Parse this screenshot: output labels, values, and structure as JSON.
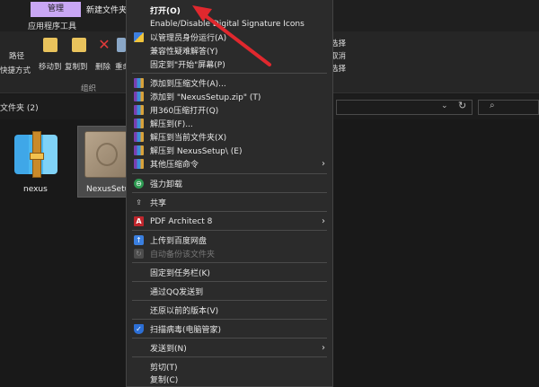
{
  "window": {
    "manage_tab": "管理",
    "title": "新建文件夹 (",
    "app_tools_tab": "应用程序工具"
  },
  "ribbon": {
    "path_label": "路径",
    "shortcut_label": "快捷方式",
    "move_to": "移动到",
    "copy_to": "复制到",
    "delete": "删除",
    "rename": "重命",
    "group_label": "组织",
    "select_all": "选择",
    "cancel_select": "取消",
    "invert_select": "选择"
  },
  "address": {
    "path": "文件夹 (2)",
    "dropdown_icon": "chevron-down-icon",
    "refresh_icon": "refresh-icon",
    "search_icon": "search-icon"
  },
  "files": [
    {
      "name": "nexus",
      "icon": "winrar-archive-icon"
    },
    {
      "name": "NexusSetup",
      "icon": "installer-box-icon"
    }
  ],
  "menu": {
    "items": [
      {
        "label": "打开(O)"
      },
      {
        "label": "Enable/Disable Digital Signature Icons"
      },
      {
        "label": "以管理员身份运行(A)"
      },
      {
        "label": "兼容性疑难解答(Y)"
      },
      {
        "label": "固定到\"开始\"屏幕(P)"
      },
      {
        "label": "添加到压缩文件(A)..."
      },
      {
        "label": "添加到 \"NexusSetup.zip\" (T)"
      },
      {
        "label": "用360压缩打开(Q)"
      },
      {
        "label": "解压到(F)..."
      },
      {
        "label": "解压到当前文件夹(X)"
      },
      {
        "label": "解压到 NexusSetup\\ (E)"
      },
      {
        "label": "其他压缩命令"
      },
      {
        "label": "强力卸载"
      },
      {
        "label": "共享"
      },
      {
        "label": "PDF Architect 8"
      },
      {
        "label": "上传到百度网盘"
      },
      {
        "label": "自动备份该文件夹"
      },
      {
        "label": "固定到任务栏(K)"
      },
      {
        "label": "通过QQ发送到"
      },
      {
        "label": "还原以前的版本(V)"
      },
      {
        "label": "扫描病毒(电脑管家)"
      },
      {
        "label": "发送到(N)"
      },
      {
        "label": "剪切(T)"
      },
      {
        "label": "复制(C)"
      }
    ],
    "submenu_glyph": "›",
    "pdf_icon_letter": "A"
  },
  "colors": {
    "menu_bg": "#2b2b2b",
    "manage_tab": "#c9a7f5",
    "arrow": "#e0282e"
  }
}
